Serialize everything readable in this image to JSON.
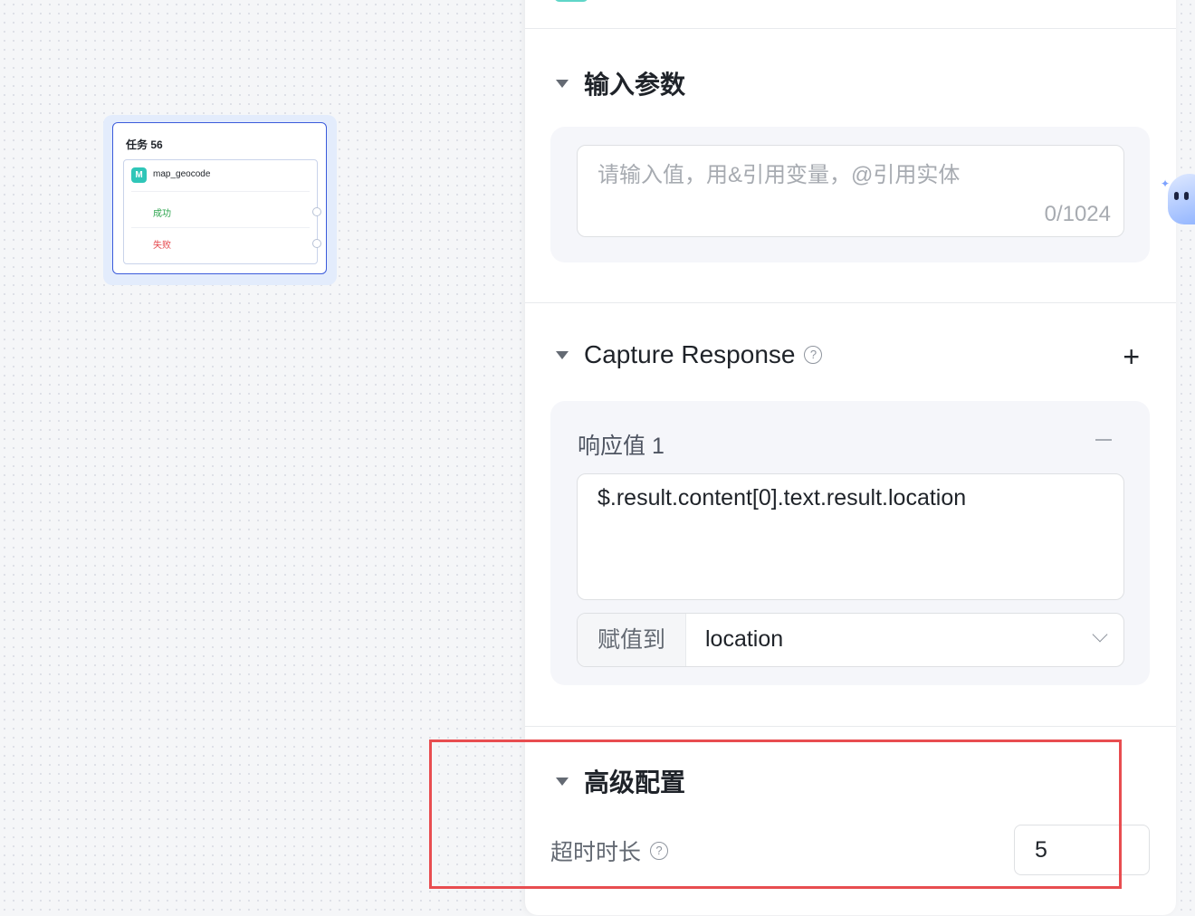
{
  "canvas": {
    "node": {
      "title": "任务 56",
      "tool_icon": "M",
      "tool_name": "map_geocode",
      "branches": {
        "success": "成功",
        "fail": "失败"
      }
    }
  },
  "panel": {
    "input_section": {
      "title": "输入参数",
      "placeholder": "请输入值，用&引用变量，@引用实体",
      "counter": "0/1024"
    },
    "capture_section": {
      "title": "Capture Response",
      "help_icon": "?",
      "add_icon": "+",
      "responses": [
        {
          "label": "响应值 1",
          "expression": "$.result.content[0].text.result.location",
          "assign_label": "赋值到",
          "assign_value": "location"
        }
      ]
    },
    "advanced_section": {
      "title": "高级配置",
      "timeout_label": "超时时长",
      "help_icon": "?",
      "timeout_value": "5"
    }
  },
  "colors": {
    "accent": "#3b5bdb",
    "tool_icon": "#2fc6b8",
    "success": "#2da44e",
    "fail": "#e5484d",
    "highlight": "#e84d50"
  }
}
